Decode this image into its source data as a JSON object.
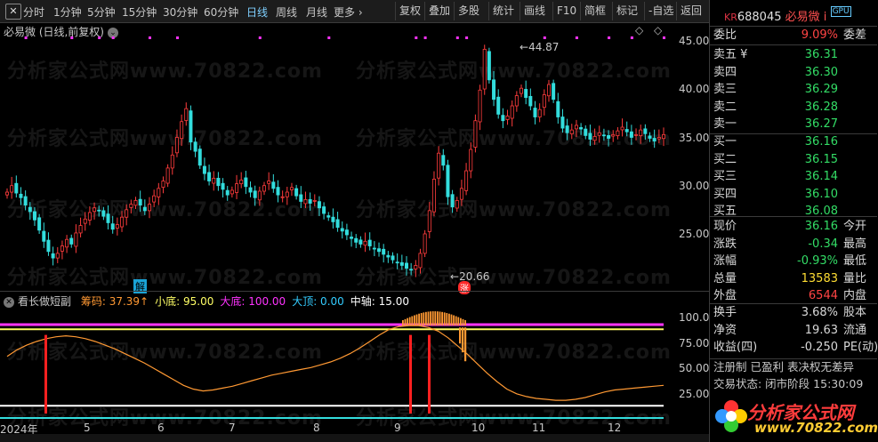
{
  "toolbar": {
    "items": [
      "分时",
      "1分钟",
      "5分钟",
      "15分钟",
      "30分钟",
      "60分钟",
      "日线",
      "周线",
      "月线",
      "更多 ›"
    ],
    "active_index": 6,
    "right_items": [
      "复权",
      "叠加",
      "多股",
      "统计",
      "画线",
      "F10",
      "简框",
      "标记",
      "-自选",
      "返回"
    ]
  },
  "main_chart": {
    "title": "必易微 (日线,前复权)",
    "y_labels": [
      "45.00",
      "40.00",
      "35.00",
      "30.00",
      "25.00"
    ],
    "high_label": "44.87",
    "low_label": "20.66",
    "jie_badge": "解",
    "zhang_badge": "涨",
    "prices": [
      29.2,
      29.9,
      29.1,
      28.6,
      27.8,
      27.1,
      26.2,
      25.1,
      23.9,
      22.8,
      22.1,
      22.6,
      23.4,
      24.1,
      23.6,
      24.8,
      25.6,
      26.3,
      27.0,
      27.5,
      27.2,
      26.6,
      25.9,
      25.2,
      25.7,
      26.5,
      27.3,
      27.9,
      28.3,
      27.8,
      27.2,
      27.9,
      28.8,
      29.6,
      30.4,
      31.8,
      33.2,
      35.1,
      36.8,
      38.2,
      34.6,
      33.6,
      32.1,
      31.2,
      30.4,
      30.7,
      29.9,
      29.5,
      28.9,
      29.4,
      30.1,
      30.5,
      29.8,
      29.2,
      28.6,
      29.3,
      29.9,
      30.4,
      29.6,
      28.9,
      28.7,
      29.2,
      29.7,
      28.8,
      28.2,
      28.4,
      28.0,
      28.3,
      27.5,
      26.9,
      26.5,
      26.0,
      25.4,
      25.0,
      24.6,
      24.2,
      23.8,
      23.6,
      23.9,
      23.4,
      23.1,
      22.8,
      22.5,
      22.2,
      21.9,
      21.6,
      21.3,
      21.0,
      20.8,
      21.3,
      22.6,
      24.7,
      27.2,
      30.6,
      33.4,
      32.1,
      28.7,
      27.6,
      28.3,
      29.6,
      31.5,
      33.8,
      36.9,
      40.2,
      44.6,
      41.3,
      39.2,
      37.6,
      36.9,
      37.4,
      38.5,
      39.6,
      40.4,
      39.4,
      38.5,
      37.3,
      38.1,
      39.7,
      40.8,
      39.2,
      37.3,
      36.1,
      35.6,
      35.9,
      36.4,
      36.0,
      35.3,
      34.9,
      35.2,
      35.6,
      35.3,
      35.0,
      35.4,
      35.8,
      36.2,
      35.7,
      35.1,
      35.4,
      35.9,
      35.5,
      35.0,
      34.7,
      35.1,
      35.4
    ],
    "magenta_marks": [
      4,
      14,
      20,
      23,
      31,
      37,
      55,
      70,
      89,
      91,
      98,
      100,
      117,
      124,
      131,
      136,
      143
    ],
    "events": [
      "◇",
      "◇"
    ]
  },
  "sub_chart": {
    "title": "看长做短副",
    "items": [
      {
        "label": "筹码: 37.39↑",
        "color": "#ff9933"
      },
      {
        "label": "小底: 95.00",
        "color": "#ffff66"
      },
      {
        "label": "大底: 100.00",
        "color": "#ff33ff"
      },
      {
        "label": "大顶: 0.00",
        "color": "#33ccff"
      },
      {
        "label": "中轴: 15.00",
        "color": "#ffffff"
      }
    ],
    "y_labels": [
      "100.0",
      "75.00",
      "50.00",
      "25.00"
    ],
    "line": [
      65,
      72,
      77,
      81,
      84,
      86,
      87,
      86,
      84,
      81,
      77,
      73,
      68,
      63,
      58,
      52,
      46,
      40,
      34,
      30,
      28,
      29,
      31,
      33,
      36,
      39,
      42,
      45,
      47,
      49,
      51,
      53,
      56,
      59,
      63,
      68,
      74,
      81,
      88,
      94,
      97,
      98,
      98,
      96,
      92,
      85,
      76,
      67,
      57,
      47,
      38,
      30,
      25,
      22,
      20,
      19,
      18,
      18,
      19,
      21,
      24,
      27,
      29,
      30,
      31,
      32,
      33,
      34
    ]
  },
  "x_ticks": [
    "2024年",
    "5",
    "6",
    "7",
    "8",
    "9",
    "10",
    "11",
    "12"
  ],
  "quote": {
    "market": "KR",
    "code": "688045",
    "name": "必易微",
    "mark": "i",
    "badge": "GPU",
    "webi": {
      "label": "委比",
      "value": "9.09%",
      "label2": "委差"
    },
    "asks": [
      {
        "label": "卖五 ¥",
        "price": "36.31"
      },
      {
        "label": "卖四",
        "price": "36.30"
      },
      {
        "label": "卖三",
        "price": "36.29"
      },
      {
        "label": "卖二",
        "price": "36.28"
      },
      {
        "label": "卖一",
        "price": "36.27"
      }
    ],
    "bids": [
      {
        "label": "买一",
        "price": "36.16"
      },
      {
        "label": "买二",
        "price": "36.15"
      },
      {
        "label": "买三",
        "price": "36.14"
      },
      {
        "label": "买四",
        "price": "36.10"
      },
      {
        "label": "买五",
        "price": "36.08"
      }
    ],
    "stats1": [
      {
        "label": "现价",
        "value": "36.16",
        "label2": "今开",
        "color": "#33dd66"
      },
      {
        "label": "涨跌",
        "value": "-0.34",
        "label2": "最高",
        "color": "#33dd66"
      },
      {
        "label": "涨幅",
        "value": "-0.93%",
        "label2": "最低",
        "color": "#33dd66"
      },
      {
        "label": "总量",
        "value": "13583",
        "label2": "量比",
        "color": "#ffdd33"
      },
      {
        "label": "外盘",
        "value": "6544",
        "label2": "内盘",
        "color": "#ff4444"
      }
    ],
    "stats2": [
      {
        "label": "换手",
        "value": "3.68%",
        "label2": "股本",
        "color": "#d8d8d8"
      },
      {
        "label": "净资",
        "value": "19.63",
        "label2": "流通",
        "color": "#d8d8d8"
      },
      {
        "label": "收益(四)",
        "value": "-0.250",
        "label2": "PE(动)",
        "color": "#d8d8d8"
      }
    ],
    "tags": "注册制 已盈利 表决权无差异",
    "trade_status": "交易状态: 闭市阶段 15:30:09"
  },
  "logo": {
    "title": "分析家公式网",
    "url": "www.70822.com"
  },
  "watermark": "分析家公式网www.70822.com",
  "colors": {
    "up": "#ff3c3c",
    "down": "#33dddd",
    "magenta": "#ff33ff",
    "yellow": "#ffff66",
    "orange": "#ff9933"
  }
}
